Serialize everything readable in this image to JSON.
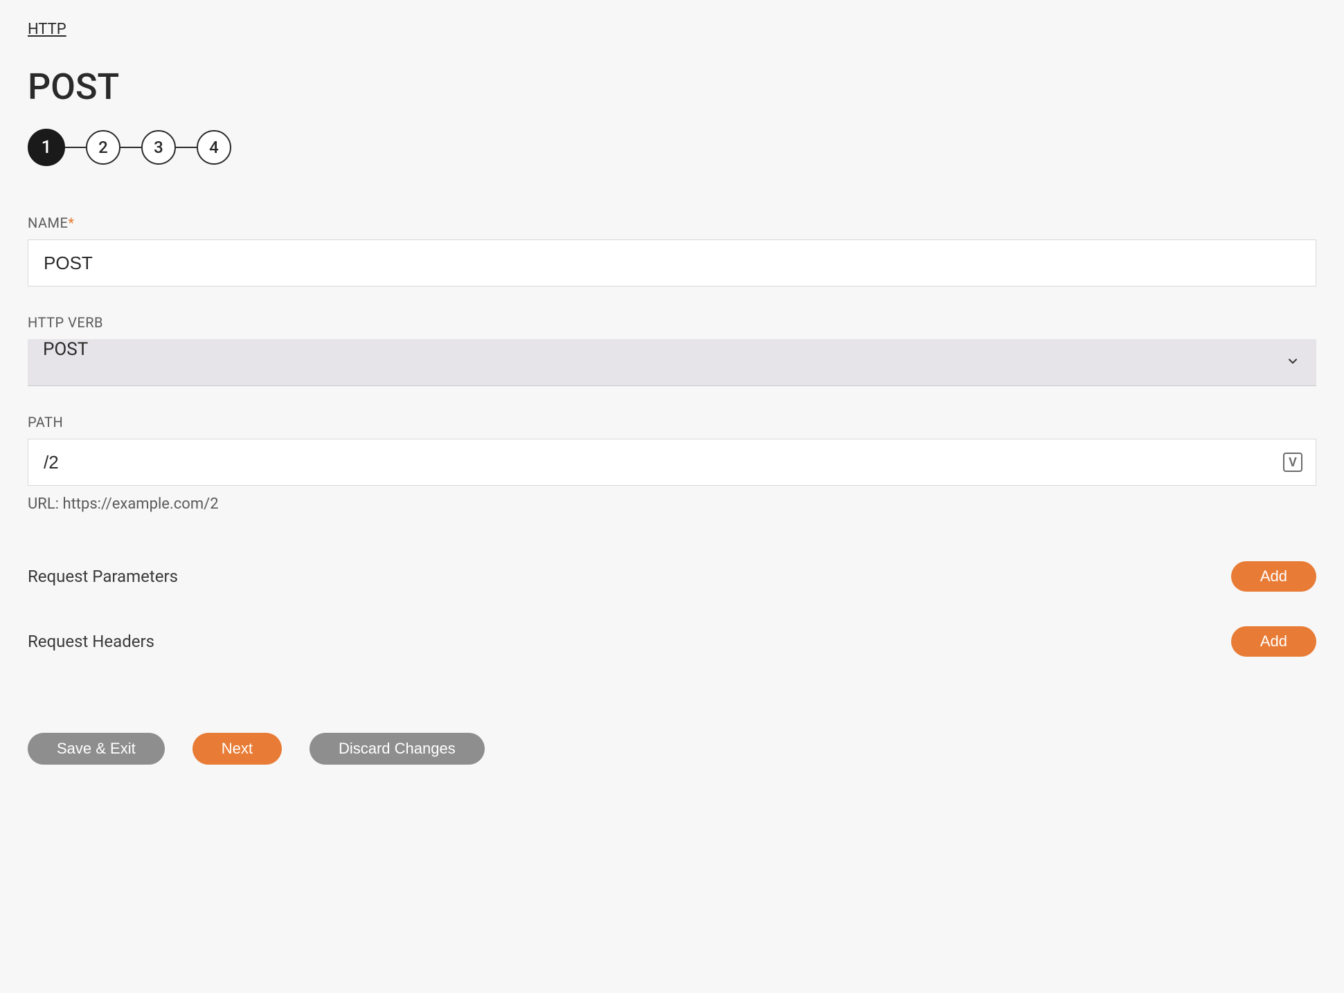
{
  "breadcrumb": "HTTP",
  "title": "POST",
  "stepper": {
    "steps": [
      "1",
      "2",
      "3",
      "4"
    ],
    "active_index": 0
  },
  "fields": {
    "name": {
      "label": "NAME",
      "required_mark": "*",
      "value": "POST"
    },
    "verb": {
      "label": "HTTP VERB",
      "value": "POST"
    },
    "path": {
      "label": "PATH",
      "value": "/2",
      "url_line": "URL: https://example.com/2",
      "var_icon_glyph": "V"
    }
  },
  "sections": {
    "params": {
      "label": "Request Parameters",
      "add_label": "Add"
    },
    "headers": {
      "label": "Request Headers",
      "add_label": "Add"
    }
  },
  "buttons": {
    "save_exit": "Save & Exit",
    "next": "Next",
    "discard": "Discard Changes"
  }
}
